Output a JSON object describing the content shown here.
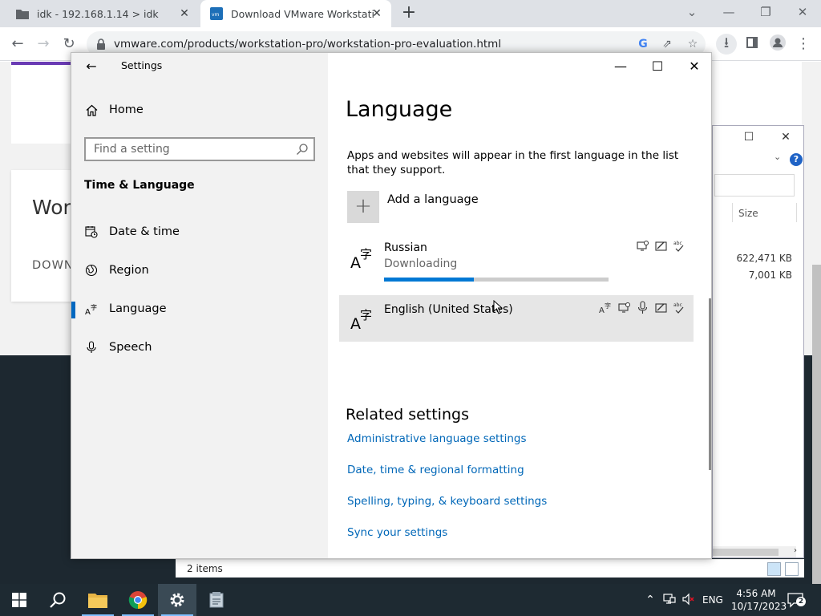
{
  "browser": {
    "tabs": [
      {
        "title": "idk - 192.168.1.14 > idk",
        "active": false
      },
      {
        "title": "Download VMware Workstation Pro | VMware",
        "active": true
      }
    ],
    "new_tab": "+",
    "url": "vmware.com/products/workstation-pro/workstation-pro-evaluation.html"
  },
  "background_page": {
    "heading_partial": "Wor",
    "download_partial": "DOWN"
  },
  "explorer": {
    "column_size": "Size",
    "sizes": [
      "622,471 KB",
      "7,001 KB"
    ],
    "status": "2 items",
    "help": "?"
  },
  "settings": {
    "window_title": "Settings",
    "home": "Home",
    "search_placeholder": "Find a setting",
    "section": "Time & Language",
    "nav": [
      {
        "label": "Date & time",
        "icon": "calendar-clock-icon"
      },
      {
        "label": "Region",
        "icon": "globe-icon"
      },
      {
        "label": "Language",
        "icon": "language-icon",
        "selected": true
      },
      {
        "label": "Speech",
        "icon": "microphone-icon"
      }
    ],
    "page_title": "Language",
    "description": "Apps and websites will appear in the first language in the list that they support.",
    "add_language": "Add a language",
    "languages": [
      {
        "name": "Russian",
        "status": "Downloading",
        "progress_percent": 40
      },
      {
        "name": "English (United States)",
        "status": ""
      }
    ],
    "related_heading": "Related settings",
    "related_links": [
      "Administrative language settings",
      "Date, time & regional formatting",
      "Spelling, typing, & keyboard settings",
      "Sync your settings"
    ]
  },
  "taskbar": {
    "input_lang": "ENG",
    "time": "4:56 AM",
    "date": "10/17/2023",
    "notifications": "2"
  },
  "colors": {
    "accent": "#0078d4",
    "link": "#0067b8",
    "taskbar": "#1e2a32"
  }
}
